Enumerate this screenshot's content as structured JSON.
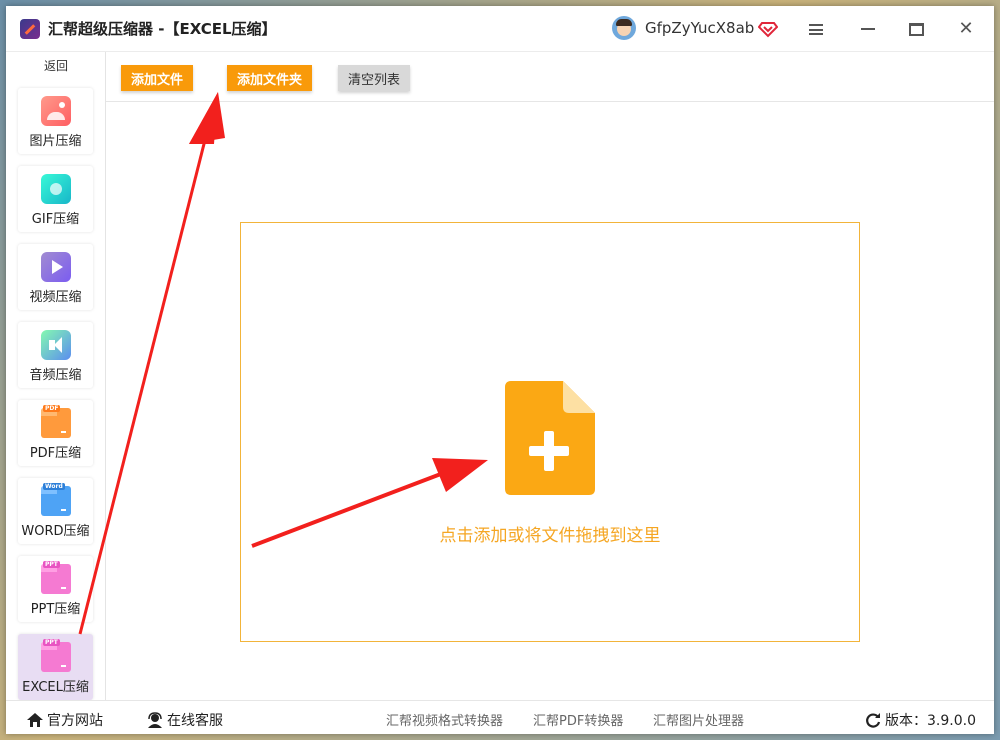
{
  "window": {
    "title": "汇帮超级压缩器  -【EXCEL压缩】",
    "username": "GfpZyYucX8ab"
  },
  "colors": {
    "accent_orange": "#f99a0a",
    "dropzone_border": "#f2b43a",
    "hint_text": "#f5a623",
    "active_nav": "#e8ddf3",
    "arrow_red": "#f2201d"
  },
  "sidebar": {
    "back_label": "返回",
    "items": [
      {
        "label": "图片压缩",
        "icon": "image-compress-icon"
      },
      {
        "label": "GIF压缩",
        "icon": "gif-compress-icon"
      },
      {
        "label": "视频压缩",
        "icon": "video-compress-icon"
      },
      {
        "label": "音频压缩",
        "icon": "audio-compress-icon"
      },
      {
        "label": "PDF压缩",
        "icon": "pdf-folder-icon",
        "tag": "PDF"
      },
      {
        "label": "WORD压缩",
        "icon": "word-folder-icon",
        "tag": "Word"
      },
      {
        "label": "PPT压缩",
        "icon": "ppt-folder-icon",
        "tag": "PPT"
      },
      {
        "label": "EXCEL压缩",
        "icon": "excel-folder-icon",
        "tag": "PPT",
        "active": true
      }
    ]
  },
  "toolbar": {
    "add_file": "添加文件",
    "add_folder": "添加文件夹",
    "clear_list": "清空列表"
  },
  "dropzone": {
    "hint": "点击添加或将文件拖拽到这里",
    "icon": "file-add-icon"
  },
  "footer": {
    "official_site": "官方网站",
    "online_service": "在线客服",
    "links": [
      "汇帮视频格式转换器",
      "汇帮PDF转换器",
      "汇帮图片处理器"
    ],
    "version_label": "版本：3.9.0.0"
  }
}
